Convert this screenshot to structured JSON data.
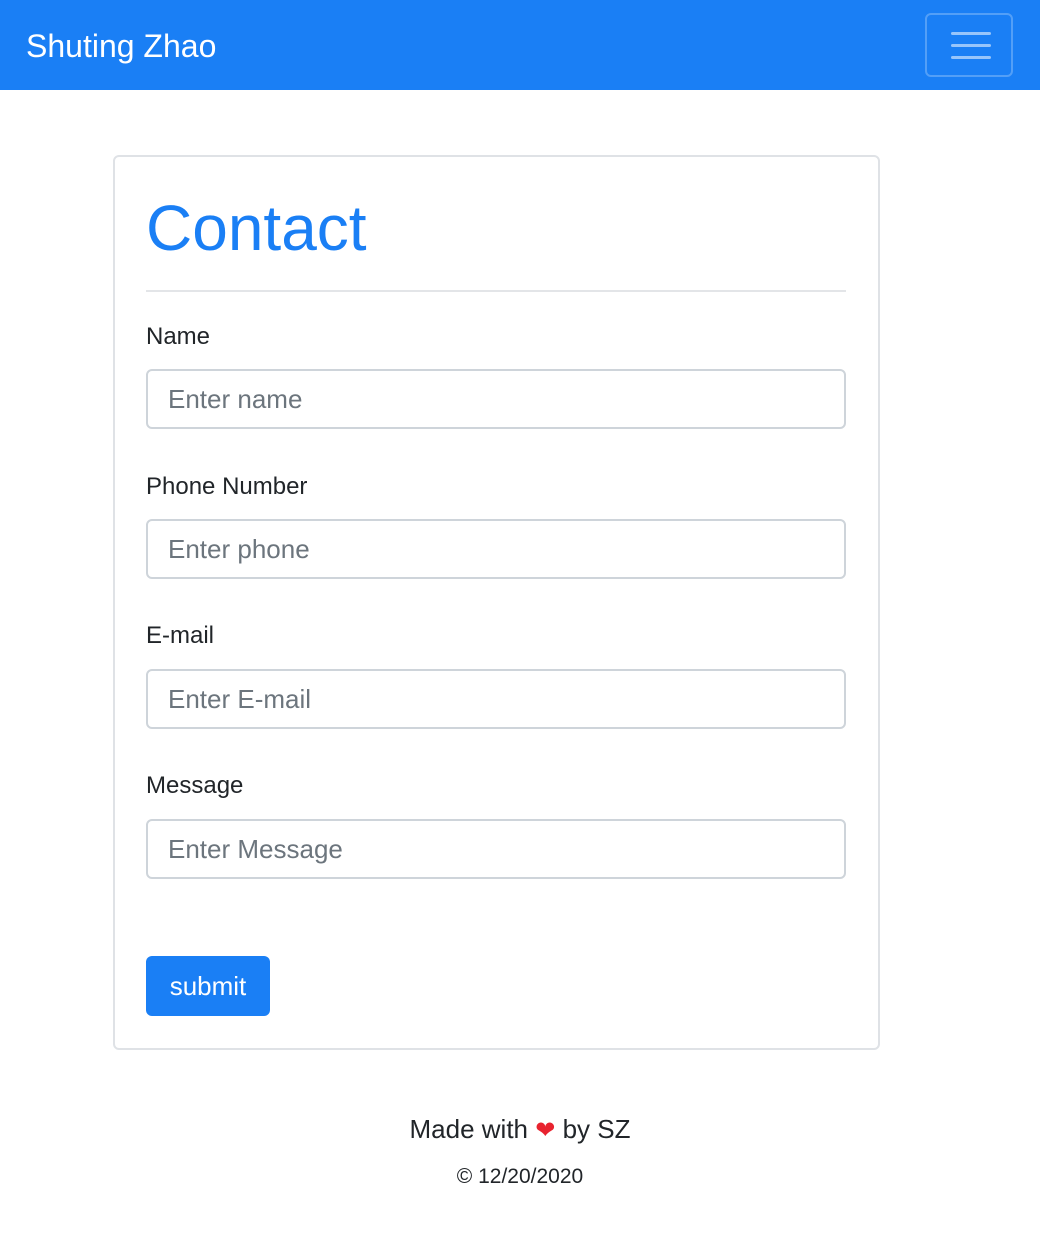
{
  "navbar": {
    "brand": "Shuting Zhao",
    "toggle_icon": "hamburger-menu-icon"
  },
  "contact": {
    "title": "Contact",
    "fields": [
      {
        "label": "Name",
        "placeholder": "Enter name"
      },
      {
        "label": "Phone Number",
        "placeholder": "Enter phone"
      },
      {
        "label": "E-mail",
        "placeholder": "Enter E-mail"
      },
      {
        "label": "Message",
        "placeholder": "Enter Message"
      }
    ],
    "submit_label": "submit"
  },
  "footer": {
    "made_prefix": "Made with",
    "heart": "❤",
    "made_suffix": "by SZ",
    "date": "© 12/20/2020"
  },
  "colors": {
    "primary": "#1a7ff5",
    "heart": "#e8232f"
  }
}
